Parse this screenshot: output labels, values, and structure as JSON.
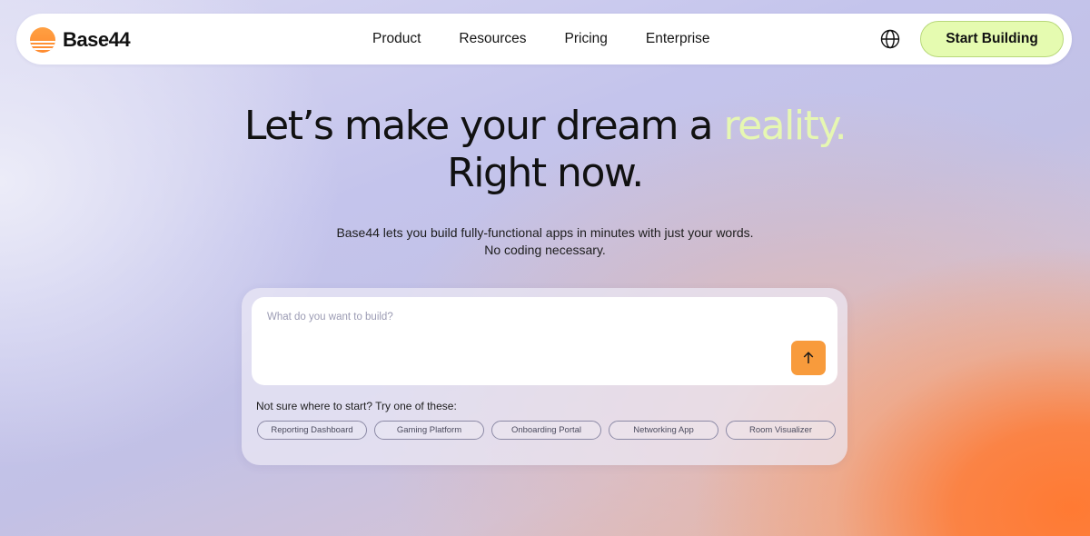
{
  "brand": {
    "name": "Base44",
    "colors": {
      "logo": "#ff8a2e",
      "cta_bg": "#e5fbb0",
      "accent_text": "#e6f7b2",
      "send_button": "#f89b3c"
    }
  },
  "nav": {
    "links": [
      "Product",
      "Resources",
      "Pricing",
      "Enterprise"
    ],
    "language_icon": "globe-icon",
    "cta_label": "Start Building"
  },
  "hero": {
    "title_part1": "Let’s make your dream a ",
    "title_accent": "reality.",
    "title_line2": "Right now.",
    "subtitle_line1": "Base44 lets you build fully-functional apps in minutes with just your words.",
    "subtitle_line2": "No coding necessary."
  },
  "prompt": {
    "placeholder": "What do you want to build?",
    "value": "",
    "send_icon": "arrow-up-icon",
    "suggestions_label": "Not sure where to start? Try one of these:",
    "suggestions": [
      "Reporting Dashboard",
      "Gaming Platform",
      "Onboarding Portal",
      "Networking App",
      "Room Visualizer"
    ]
  }
}
